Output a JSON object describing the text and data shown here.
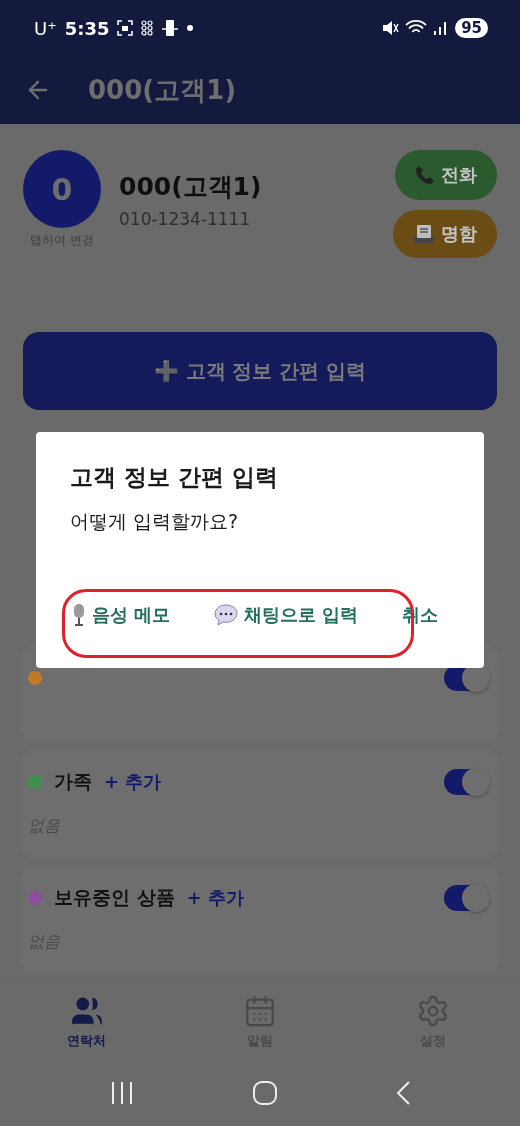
{
  "status_bar": {
    "carrier": "U⁺",
    "time": "5:35",
    "battery": "95"
  },
  "app_bar": {
    "title": "000(고객1)"
  },
  "profile": {
    "avatar_letter": "0",
    "avatar_hint": "탭하여 변경",
    "name": "000(고객1)",
    "phone": "010-1234-1111"
  },
  "actions": [
    {
      "kind": "call",
      "label": "전화"
    },
    {
      "kind": "card",
      "label": "명함"
    }
  ],
  "quick_input_button": {
    "emoji": "➕",
    "label": "고객 정보 간편 입력"
  },
  "cards": [
    {
      "color": "#c07a2a",
      "on": true
    },
    {
      "name": "가족",
      "add": "+ 추가",
      "color": "#3f8f4f",
      "on": true,
      "empty": "없음"
    },
    {
      "name": "보유중인 상품",
      "add": "+ 추가",
      "color": "#8a4f9e",
      "on": true,
      "empty": "없음"
    }
  ],
  "dialog": {
    "title": "고객 정보 간편 입력",
    "message": "어떻게 입력할까요?",
    "buttons": [
      {
        "kind": "voice",
        "label": "음성 메모"
      },
      {
        "kind": "chat",
        "label": "채팅으로 입력"
      },
      {
        "kind": "cancel",
        "label": "취소"
      }
    ],
    "highlight": true
  },
  "bottom_nav": [
    {
      "kind": "contacts",
      "label": "연락처",
      "selected": true
    },
    {
      "kind": "alarm",
      "label": "알림",
      "selected": false
    },
    {
      "kind": "settings",
      "label": "설정",
      "selected": false
    }
  ]
}
